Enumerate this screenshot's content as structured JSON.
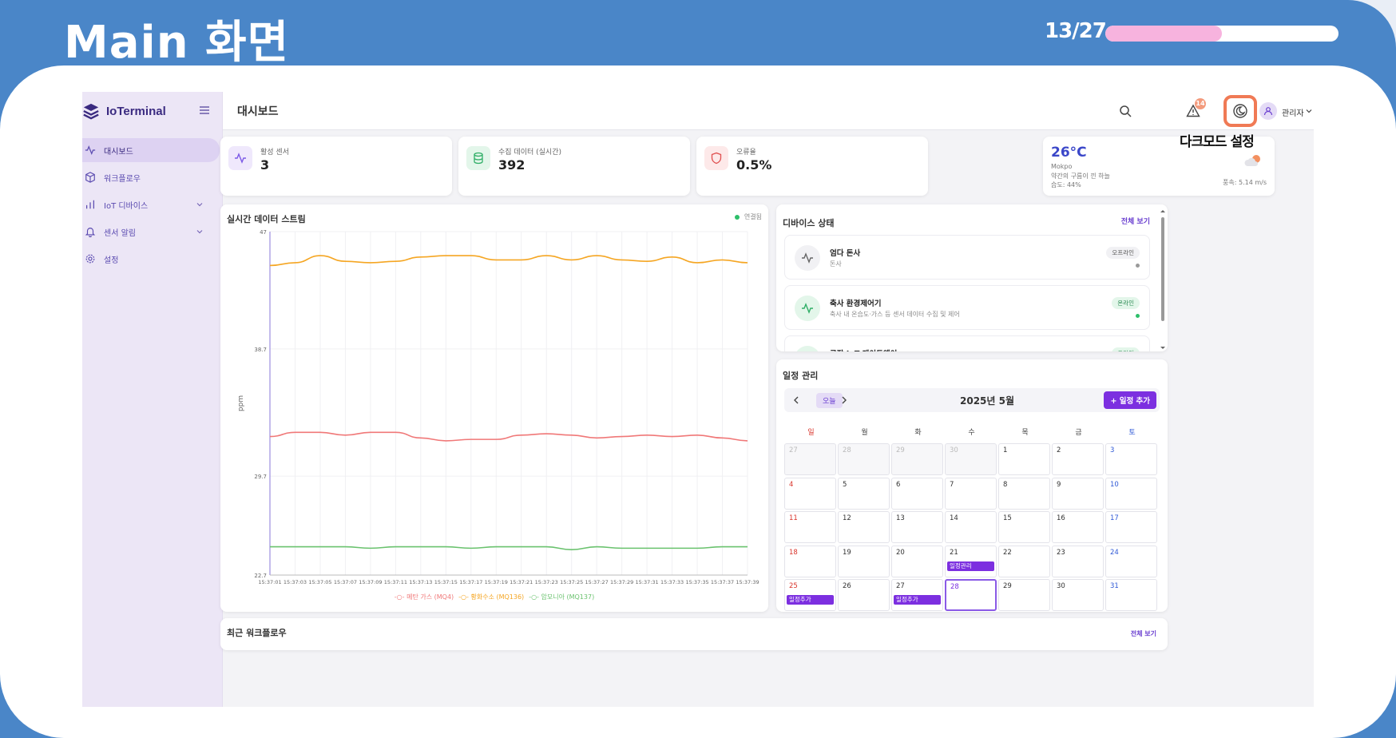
{
  "slide": {
    "title": "Main 화면",
    "page": "13/27",
    "progress": 0.5
  },
  "app": {
    "brand": "IoTerminal",
    "page_title": "대시보드"
  },
  "sidebar": {
    "items": [
      {
        "label": "대시보드",
        "icon": "activity-icon",
        "active": true
      },
      {
        "label": "워크플로우",
        "icon": "box-icon"
      },
      {
        "label": "IoT 디바이스",
        "icon": "bar-chart-icon",
        "expandable": true
      },
      {
        "label": "센서 알림",
        "icon": "bell-icon",
        "expandable": true
      },
      {
        "label": "설정",
        "icon": "gear-icon"
      }
    ]
  },
  "topbar": {
    "notification_count": "14",
    "user": "관리자",
    "callout": "다크모드 설정"
  },
  "stats": [
    {
      "label": "활성 센서",
      "value": "3",
      "icon": "activity-icon",
      "color": "#7c5ae6",
      "bg": "#efe8fc"
    },
    {
      "label": "수집 데이터 (실시간)",
      "value": "392",
      "icon": "database-icon",
      "color": "#2fae66",
      "bg": "#e3f6ea"
    },
    {
      "label": "오류율",
      "value": "0.5%",
      "icon": "shield-icon",
      "color": "#e05050",
      "bg": "#fde9e9"
    }
  ],
  "weather": {
    "temp": "26°C",
    "city": "Mokpo",
    "desc": "약간의 구름이 낀 하늘",
    "humidity": "습도: 44%",
    "wind": "풍속: 5.14 m/s",
    "icon": "partly-cloudy-icon"
  },
  "stream": {
    "title": "실시간 데이터 스트림",
    "status": "연결됨"
  },
  "chart_data": {
    "type": "line",
    "title": "실시간 데이터 스트림",
    "ylabel": "ppm",
    "ylim": [
      22.7,
      47
    ],
    "yticks": [
      "47",
      "38.7",
      "29.7",
      "22.7"
    ],
    "x": [
      "15:37:01",
      "15:37:03",
      "15:37:05",
      "15:37:07",
      "15:37:09",
      "15:37:11",
      "15:37:13",
      "15:37:15",
      "15:37:17",
      "15:37:19",
      "15:37:21",
      "15:37:23",
      "15:37:25",
      "15:37:27",
      "15:37:29",
      "15:37:31",
      "15:37:33",
      "15:37:35",
      "15:37:37",
      "15:37:39"
    ],
    "series": [
      {
        "name": "메탄 가스 (MQ4)",
        "color": "#f07878",
        "values": [
          32.5,
          32.8,
          32.8,
          32.6,
          32.8,
          32.8,
          32.4,
          32.2,
          32.3,
          32.3,
          32.6,
          32.7,
          32.6,
          32.4,
          32.5,
          32.6,
          32.5,
          32.6,
          32.4,
          32.2
        ]
      },
      {
        "name": "황화수소 (MQ136)",
        "color": "#f5a623",
        "values": [
          44.6,
          44.8,
          45.3,
          44.9,
          44.8,
          44.9,
          45.2,
          45.3,
          45.3,
          45.0,
          45.0,
          45.3,
          45.0,
          45.3,
          45.0,
          44.9,
          45.2,
          44.8,
          45.0,
          44.8
        ]
      },
      {
        "name": "암모니아 (MQ137)",
        "color": "#6ac26e",
        "values": [
          24.7,
          24.7,
          24.7,
          24.7,
          24.6,
          24.7,
          24.7,
          24.7,
          24.6,
          24.7,
          24.7,
          24.7,
          24.5,
          24.7,
          24.6,
          24.6,
          24.6,
          24.6,
          24.7,
          24.7
        ]
      }
    ],
    "grid": true,
    "legend": "bottom"
  },
  "devices": {
    "title": "디바이스 상태",
    "view_all": "전체 보기",
    "items": [
      {
        "name": "엄다 돈사",
        "desc": "돈사",
        "status": "오프라인",
        "online": false
      },
      {
        "name": "축사 환경제어기",
        "desc": "축사 내 온습도·가스 등 센서 데이터 수집 및 제어",
        "status": "온라인",
        "online": true
      },
      {
        "name": "공장 IoT 게이트웨이",
        "desc": "",
        "status": "온라인",
        "online": true
      }
    ]
  },
  "calendar": {
    "title": "일정 관리",
    "today_label": "오늘",
    "month": "2025년 5월",
    "add_label": "+ 일정 추가",
    "days": [
      "일",
      "월",
      "화",
      "수",
      "목",
      "금",
      "토"
    ],
    "cells": [
      {
        "d": "27",
        "o": true
      },
      {
        "d": "28",
        "o": true
      },
      {
        "d": "29",
        "o": true
      },
      {
        "d": "30",
        "o": true
      },
      {
        "d": "1"
      },
      {
        "d": "2"
      },
      {
        "d": "3"
      },
      {
        "d": "4"
      },
      {
        "d": "5"
      },
      {
        "d": "6"
      },
      {
        "d": "7"
      },
      {
        "d": "8"
      },
      {
        "d": "9"
      },
      {
        "d": "10"
      },
      {
        "d": "11"
      },
      {
        "d": "12"
      },
      {
        "d": "13"
      },
      {
        "d": "14"
      },
      {
        "d": "15"
      },
      {
        "d": "16"
      },
      {
        "d": "17"
      },
      {
        "d": "18"
      },
      {
        "d": "19"
      },
      {
        "d": "20"
      },
      {
        "d": "21",
        "e": "일정관리"
      },
      {
        "d": "22"
      },
      {
        "d": "23"
      },
      {
        "d": "24"
      },
      {
        "d": "25",
        "e": "일정추가"
      },
      {
        "d": "26"
      },
      {
        "d": "27",
        "e": "일정추가"
      },
      {
        "d": "28",
        "t": true
      },
      {
        "d": "29"
      },
      {
        "d": "30"
      },
      {
        "d": "31"
      }
    ]
  },
  "workflows": {
    "title": "최근 워크플로우",
    "view_all": "전체 보기"
  }
}
